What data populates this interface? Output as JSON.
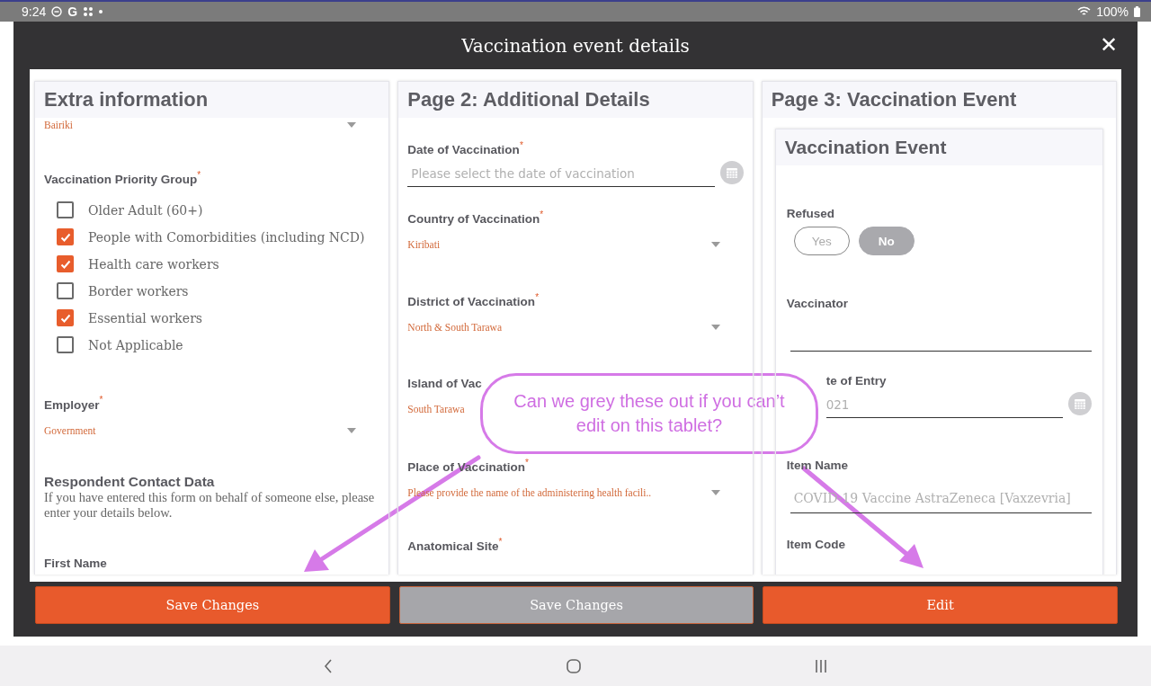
{
  "status_bar": {
    "time": "9:24",
    "letter": "G",
    "battery": "100%"
  },
  "dialog": {
    "title": "Vaccination event details",
    "close": "✕"
  },
  "columns": [
    {
      "title": "Extra information",
      "fields": [
        {
          "kind": "select",
          "value": "Bairiki",
          "dropdown": true
        },
        {
          "kind": "checkboxes",
          "label": "Vaccination Priority Group",
          "asterisk": "*",
          "options": [
            {
              "label": "Older Adult (60+)",
              "checked": false
            },
            {
              "label": "People with Comorbidities (including NCD)",
              "checked": true
            },
            {
              "label": "Health care workers",
              "checked": true
            },
            {
              "label": "Border workers",
              "checked": false
            },
            {
              "label": "Essential workers",
              "checked": true
            },
            {
              "label": "Not Applicable",
              "checked": false
            }
          ]
        },
        {
          "kind": "select",
          "label": "Employer",
          "asterisk": "*",
          "value": "Government",
          "dropdown": true
        },
        {
          "kind": "section",
          "heading": "Respondent Contact Data",
          "text": "If you have entered this form on behalf of someone else, please enter your details below."
        },
        {
          "kind": "label",
          "label": "First Name"
        }
      ]
    },
    {
      "title": "Page 2: Additional Details",
      "fields": [
        {
          "kind": "date",
          "label": "Date of Vaccination",
          "asterisk": "*",
          "placeholder": "Please select the date of vaccination"
        },
        {
          "kind": "select",
          "label": "Country of Vaccination",
          "asterisk": "*",
          "value": "Kiribati",
          "dropdown": true
        },
        {
          "kind": "select",
          "label": "District of Vaccination",
          "asterisk": "*",
          "value": "North & South Tarawa",
          "dropdown": true
        },
        {
          "kind": "select",
          "label": "Island of Vac",
          "value": "South Tarawa",
          "dropdown": false
        },
        {
          "kind": "select",
          "label": "Place of Vaccination",
          "asterisk": "*",
          "value": "Please provide the name of the administering health facili..",
          "dropdown": true
        },
        {
          "kind": "label",
          "label": "Anatomical Site",
          "asterisk": "*"
        }
      ]
    },
    {
      "title": "Page 3: Vaccination Event",
      "card": {
        "title": "Vaccination Event",
        "fields": [
          {
            "kind": "radio",
            "label": "Refused",
            "options": [
              {
                "label": "Yes",
                "selected": false
              },
              {
                "label": "No",
                "selected": true
              }
            ]
          },
          {
            "kind": "text",
            "label": "Vaccinator"
          },
          {
            "kind": "date",
            "label": "te of Entry",
            "value": "021",
            "disabled": true
          },
          {
            "kind": "text",
            "label": "Item Name",
            "value": "COVID-19 Vaccine AstraZeneca [Vaxzevria]",
            "disabled": true
          },
          {
            "kind": "label",
            "label": "Item Code"
          }
        ]
      }
    }
  ],
  "buttons": [
    {
      "label": "Save Changes",
      "disabled": false
    },
    {
      "label": "Save Changes",
      "disabled": true
    },
    {
      "label": "Edit",
      "disabled": false
    }
  ],
  "annotation": {
    "text": "Can we grey these out if you can’t edit on this tablet?"
  }
}
